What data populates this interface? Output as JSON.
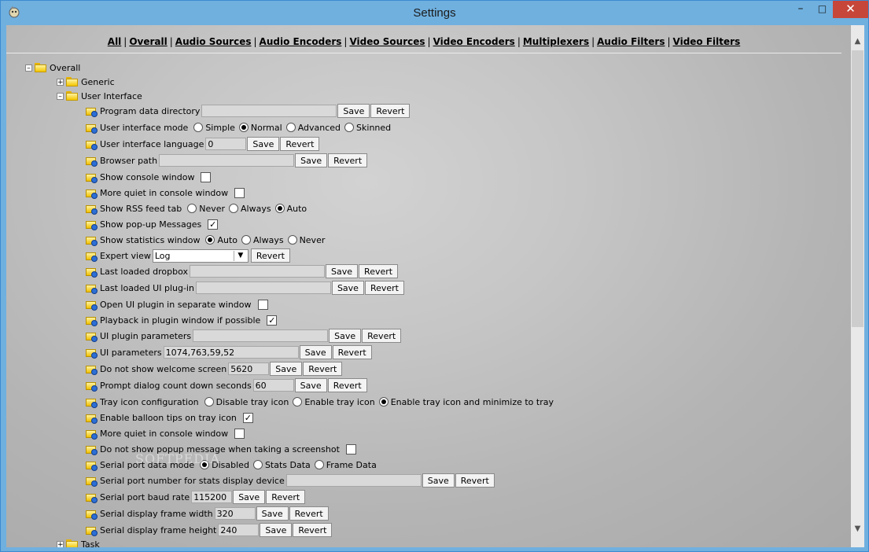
{
  "window": {
    "title": "Settings",
    "min_icon": "minimize-icon",
    "max_icon": "maximize-icon",
    "close_icon": "close-icon"
  },
  "nav": [
    "All",
    "Overall",
    "Audio Sources",
    "Audio Encoders",
    "Video Sources",
    "Video Encoders",
    "Multiplexers",
    "Audio Filters",
    "Video Filters"
  ],
  "nav_sep": "|",
  "tree": {
    "overall": "Overall",
    "generic": "Generic",
    "user_interface": "User Interface",
    "task": "Task"
  },
  "buttons": {
    "save": "Save",
    "revert": "Revert"
  },
  "settings": {
    "program_data_directory": {
      "label": "Program data directory",
      "value": ""
    },
    "user_interface_mode": {
      "label": "User interface mode",
      "options": [
        "Simple",
        "Normal",
        "Advanced",
        "Skinned"
      ],
      "selected": "Normal"
    },
    "user_interface_language": {
      "label": "User interface language",
      "value": "0"
    },
    "browser_path": {
      "label": "Browser path",
      "value": ""
    },
    "show_console_window": {
      "label": "Show console window",
      "checked": false
    },
    "more_quiet_console": {
      "label": "More quiet in console window",
      "checked": false
    },
    "show_rss_feed_tab": {
      "label": "Show RSS feed tab",
      "options": [
        "Never",
        "Always",
        "Auto"
      ],
      "selected": "Auto"
    },
    "show_popup_messages": {
      "label": "Show pop-up Messages",
      "checked": true
    },
    "show_statistics_window": {
      "label": "Show statistics window",
      "options": [
        "Auto",
        "Always",
        "Never"
      ],
      "selected": "Auto"
    },
    "expert_view": {
      "label": "Expert view",
      "value": "Log"
    },
    "last_loaded_dropbox": {
      "label": "Last loaded dropbox",
      "value": ""
    },
    "last_loaded_ui_plugin": {
      "label": "Last loaded UI plug-in",
      "value": ""
    },
    "open_ui_plugin_separate": {
      "label": "Open UI plugin in separate window",
      "checked": false
    },
    "playback_in_plugin_window": {
      "label": "Playback in plugin window if possible",
      "checked": true
    },
    "ui_plugin_parameters": {
      "label": "UI plugin parameters",
      "value": ""
    },
    "ui_parameters": {
      "label": "UI parameters",
      "value": "1074,763,59,52"
    },
    "do_not_show_welcome": {
      "label": "Do not show welcome screen",
      "value": "5620"
    },
    "prompt_dialog_countdown": {
      "label": "Prompt dialog count down seconds",
      "value": "60"
    },
    "tray_icon_configuration": {
      "label": "Tray icon configuration",
      "options": [
        "Disable tray icon",
        "Enable tray icon",
        "Enable tray icon and minimize to tray"
      ],
      "selected": "Enable tray icon and minimize to tray"
    },
    "enable_balloon_tips": {
      "label": "Enable balloon tips on tray icon",
      "checked": true
    },
    "more_quiet_console_2": {
      "label": "More quiet in console window",
      "checked": false
    },
    "no_popup_screenshot": {
      "label": "Do not show popup message when taking a screenshot",
      "checked": false
    },
    "serial_port_data_mode": {
      "label": "Serial port data mode",
      "options": [
        "Disabled",
        "Stats Data",
        "Frame Data"
      ],
      "selected": "Disabled"
    },
    "serial_port_number": {
      "label": "Serial port number for stats display device",
      "value": ""
    },
    "serial_port_baud_rate": {
      "label": "Serial port baud rate",
      "value": "115200"
    },
    "serial_display_frame_width": {
      "label": "Serial display frame width",
      "value": "320"
    },
    "serial_display_frame_height": {
      "label": "Serial display frame height",
      "value": "240"
    }
  },
  "watermark": "SOFTPEDIA"
}
